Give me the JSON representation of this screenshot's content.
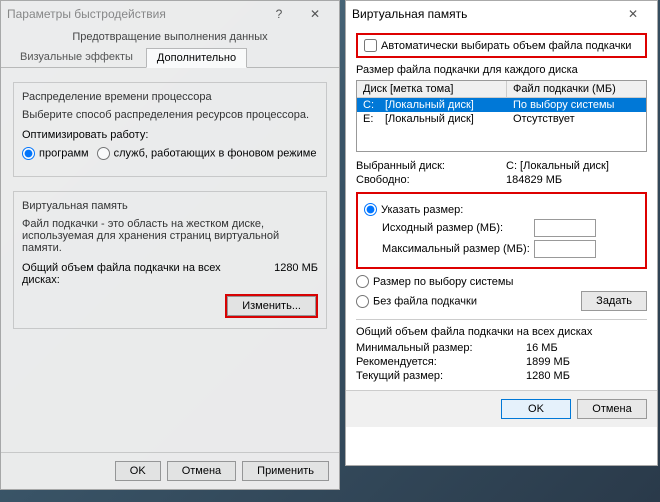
{
  "left": {
    "title": "Параметры быстродействия",
    "dep_title": "Предотвращение выполнения данных",
    "tabs": {
      "visual": "Визуальные эффекты",
      "adv": "Дополнительно"
    },
    "cpu": {
      "heading": "Распределение времени процессора",
      "desc": "Выберите способ распределения ресурсов процессора.",
      "opt_label": "Оптимизировать работу:",
      "programs": "программ",
      "services": "служб, работающих в фоновом режиме"
    },
    "vm": {
      "heading": "Виртуальная память",
      "desc": "Файл подкачки - это область на жестком диске, используемая для хранения страниц виртуальной памяти.",
      "total_label": "Общий объем файла подкачки на всех дисках:",
      "total_value": "1280 МБ",
      "change_btn": "Изменить..."
    },
    "buttons": {
      "ok": "OK",
      "cancel": "Отмена",
      "apply": "Применить"
    }
  },
  "right": {
    "title": "Виртуальная память",
    "auto_checkbox": "Автоматически выбирать объем файла подкачки",
    "list_heading": "Размер файла подкачки для каждого диска",
    "col1": "Диск [метка тома]",
    "col2": "Файл подкачки (МБ)",
    "rows": [
      {
        "drive": "C:",
        "label": "[Локальный диск]",
        "value": "По выбору системы"
      },
      {
        "drive": "E:",
        "label": "[Локальный диск]",
        "value": "Отсутствует"
      }
    ],
    "sel_disk_label": "Выбранный диск:",
    "sel_disk_value": "C: [Локальный диск]",
    "free_label": "Свободно:",
    "free_value": "184829 МБ",
    "custom_size": "Указать размер:",
    "initial_label": "Исходный размер (МБ):",
    "max_label": "Максимальный размер (МБ):",
    "system_radio": "Размер по выбору системы",
    "none_radio": "Без файла подкачки",
    "set_btn": "Задать",
    "stats_heading": "Общий объем файла подкачки на всех дисках",
    "min_label": "Минимальный размер:",
    "min_value": "16 МБ",
    "rec_label": "Рекомендуется:",
    "rec_value": "1899 МБ",
    "cur_label": "Текущий размер:",
    "cur_value": "1280 МБ",
    "ok": "OK",
    "cancel": "Отмена"
  }
}
